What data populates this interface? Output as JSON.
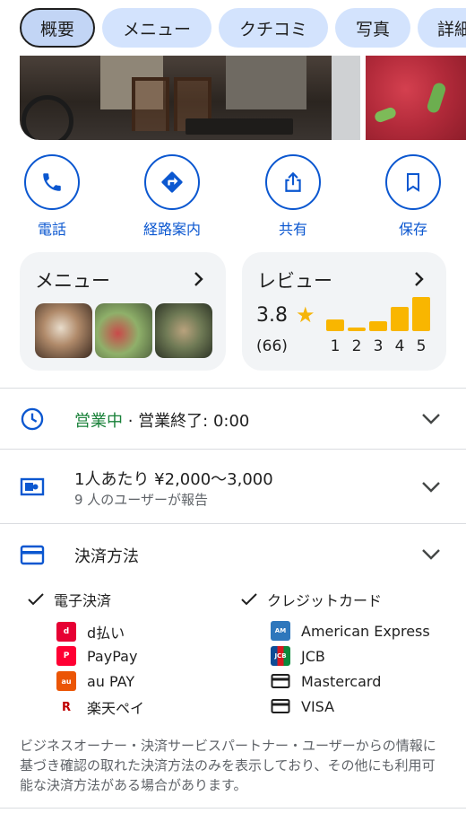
{
  "tabs": [
    {
      "label": "概要",
      "active": true
    },
    {
      "label": "メニュー",
      "active": false
    },
    {
      "label": "クチコミ",
      "active": false
    },
    {
      "label": "写真",
      "active": false
    },
    {
      "label": "詳細",
      "active": false
    }
  ],
  "actions": [
    {
      "label": "電話",
      "icon": "phone-icon"
    },
    {
      "label": "経路案内",
      "icon": "directions-icon"
    },
    {
      "label": "共有",
      "icon": "share-icon"
    },
    {
      "label": "保存",
      "icon": "bookmark-icon"
    }
  ],
  "menu_card": {
    "title": "メニュー"
  },
  "review_card": {
    "title": "レビュー",
    "rating": "3.8",
    "count": "(66)",
    "distribution_labels": [
      "1",
      "2",
      "3",
      "4",
      "5"
    ],
    "distribution": [
      0.35,
      0.1,
      0.28,
      0.7,
      1.0
    ]
  },
  "hours": {
    "status": "営業中",
    "separator": " · ",
    "detail": "営業終了: 0:00"
  },
  "price": {
    "text": "1人あたり ¥2,000～3,000",
    "sub": "9 人のユーザーが報告"
  },
  "payment": {
    "title": "決済方法",
    "electronic": {
      "heading": "電子決済",
      "items": [
        "d払い",
        "PayPay",
        "au PAY",
        "楽天ペイ"
      ]
    },
    "credit": {
      "heading": "クレジットカード",
      "items": [
        "American Express",
        "JCB",
        "Mastercard",
        "VISA"
      ]
    },
    "disclaimer": "ビジネスオーナー・決済サービスパートナー・ユーザーからの情報に基づき確認の取れた決済方法のみを表示しており、その他にも利用可能な決済方法がある場合があります。"
  },
  "colors": {
    "accent": "#0b57d0",
    "open": "#188038",
    "star": "#f9b600",
    "tab_bg": "#d3e3fd"
  }
}
